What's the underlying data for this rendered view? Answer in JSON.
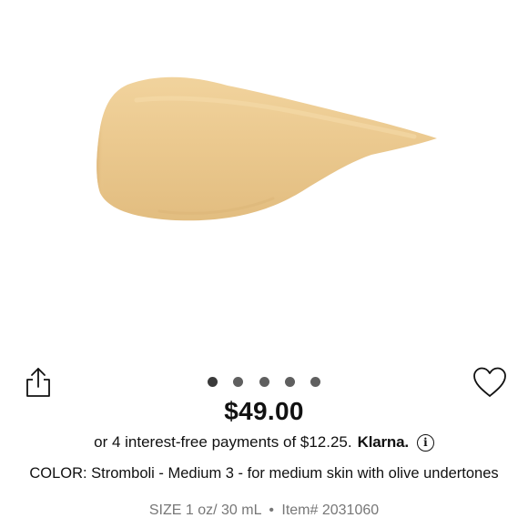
{
  "product": {
    "price": "$49.00",
    "installment_text": "or 4 interest-free payments of $12.25.",
    "klarna_label": "Klarna.",
    "info_glyph": "i",
    "color_text": "COLOR: Stromboli - Medium 3 - for medium skin with olive undertones",
    "size_text": "SIZE 1 oz/ 30 mL",
    "separator": "•",
    "item_text": "Item# 2031060"
  },
  "carousel": {
    "dot_count": 5,
    "active_index": 0
  },
  "icons": {
    "share": "share-icon",
    "heart": "heart-icon"
  },
  "colors": {
    "swatch_fill": "#EAC88E",
    "swatch_shadow": "#D8B377",
    "swatch_highlight": "#F3D8A4",
    "text": "#111111",
    "muted_text": "#777777",
    "dot": "#5F5F5F"
  }
}
